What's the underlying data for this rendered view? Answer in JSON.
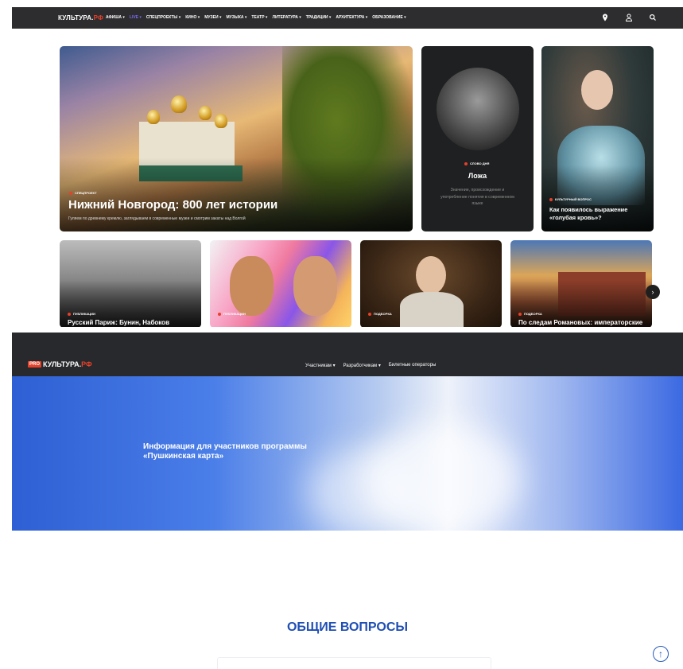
{
  "top_site": {
    "logo_main": "КУЛЬТУРА.",
    "logo_rf": "РФ",
    "nav": [
      {
        "label": "АФИША ▾",
        "accent": false
      },
      {
        "label": "LIVE ▾",
        "accent": true
      },
      {
        "label": "СПЕЦПРОЕКТЫ ▾",
        "accent": false
      },
      {
        "label": "КИНО ▾",
        "accent": false
      },
      {
        "label": "МУЗЕИ ▾",
        "accent": false
      },
      {
        "label": "МУЗЫКА ▾",
        "accent": false
      },
      {
        "label": "ТЕАТР ▾",
        "accent": false
      },
      {
        "label": "ЛИТЕРАТУРА ▾",
        "accent": false
      },
      {
        "label": "ТРАДИЦИИ ▾",
        "accent": false
      },
      {
        "label": "АРХИТЕКТУРА ▾",
        "accent": false
      },
      {
        "label": "ОБРАЗОВАНИЕ ▾",
        "accent": false
      }
    ],
    "icons": [
      "location-icon",
      "user-icon",
      "search-icon"
    ],
    "hero": {
      "tag": "СПЕЦПРОЕКТ",
      "title": "Нижний Новгород: 800 лет истории",
      "subtitle": "Гуляем по древнему кремлю, заглядываем в современные музеи и смотрим закаты над Волгой"
    },
    "word_card": {
      "tag": "СЛОВО ДНЯ",
      "title": "Ложа",
      "subtitle": "Значение, происхождение и употребление понятия в современном языке"
    },
    "question_card": {
      "tag": "КУЛЬТУРНЫЙ ВОПРОС",
      "title": "Как появилось выражение «голубая кровь»?"
    },
    "small_cards": [
      {
        "tag": "ПУБЛИКАЦИИ",
        "title": "Русский Париж: Бунин, Набоков"
      },
      {
        "tag": "ПУБЛИКАЦИИ",
        "title": ""
      },
      {
        "tag": "ПОДБОРКА",
        "title": ""
      },
      {
        "tag": "ПОДБОРКА",
        "title": "По следам Романовых: императорские"
      }
    ],
    "next_arrow": "›"
  },
  "pro_site": {
    "logo_pro": "PRO",
    "logo_main": "КУЛЬТУРА.",
    "logo_rf": "РФ",
    "nav": [
      "Участникам ▾",
      "Разработчикам ▾",
      "Билетные операторы"
    ],
    "banner_title": "Информация для участников программы «Пушкинская карта»",
    "faq_heading": "ОБЩИЕ ВОПРОСЫ",
    "scroll_top": "↑"
  },
  "colors": {
    "accent_red": "#e5412b",
    "live_purple": "#7a6cf0",
    "heading_blue": "#1f4fb4",
    "nav_dark": "#2d2d2f"
  }
}
